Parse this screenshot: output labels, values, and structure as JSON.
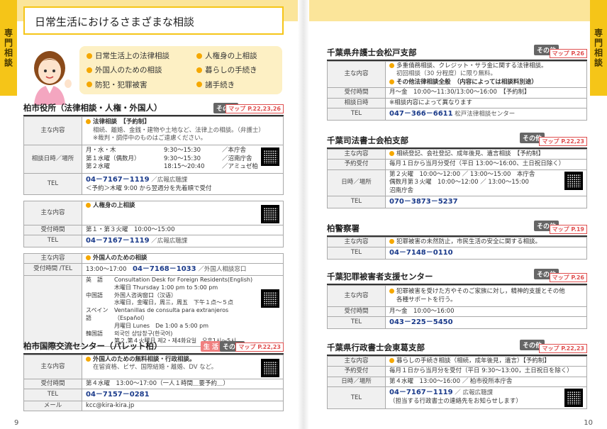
{
  "tabs": {
    "left": "専門相談",
    "right": "専門相談"
  },
  "page_numbers": {
    "left": "9",
    "right": "10"
  },
  "title": "日常生活におけるさまざまな相談",
  "topics": [
    "日常生活上の法律相談",
    "人権身の上相談",
    "外国人のための相談",
    "暮らしの手続き",
    "防犯・犯罪被害",
    "諸手続き"
  ],
  "kashiwa": {
    "name": "柏市役所（法律相談・人権・外国人）",
    "tag": "その他",
    "map": "マップ P.22,23,26",
    "label_content": "主な内容",
    "law_title": "法律相談　【予約制】",
    "law_desc": "相続、離婚、金銭・建物や土地など、法律上の相談。（弁護士）",
    "law_note": "※裁判・調停中のものはご遠慮ください。",
    "label_date": "相談日時／場所",
    "s1_day": "月・水・木",
    "s1_time": "9:30～15:30",
    "s1_place": "／本庁舎",
    "s2_day": "第１水曜（偶数月）",
    "s2_time": "9:30～15:30",
    "s2_place": "／沼南庁舎",
    "s3_day": "第２水曜",
    "s3_time": "18:15～20:40",
    "s3_place": "／アミュゼ柏",
    "label_tel": "TEL",
    "tel": "04－7167－1119",
    "tel_note": "／広報広聴課",
    "tel_note2": "＜予約＞木曜 9:00 から翌週分を先着順で受付",
    "jinken_content": "人権身の上相談",
    "label_time": "受付時間",
    "jinken_time": "第１・第３火曜　10:00～15:00",
    "jinken_tel": "04－7167－1119",
    "jinken_tel_note": "／広報広聴課",
    "foreign_content": "外国人のための相談",
    "label_time_tel": "受付時間 /TEL",
    "foreign_time": "13:00～17:00",
    "foreign_tel": "04－7168－1033",
    "foreign_tel_note": "／外国人相談窓口",
    "en_lang": "英　語",
    "en_1": "Consultation Desk for Foreign Residents(English)",
    "en_2": "木曜日 Thursday 1:00 pm to 5:00 pm",
    "cn_lang": "中国語",
    "cn_1": "外国人咨询窗口（汉语）",
    "cn_2": "水曜日，金曜日，周三，周五　下午１点～５点",
    "es_lang": "スペイン語",
    "es_1": "Ventanillas de consulta para extranjeros（Español）",
    "es_2": "月曜日 Lunes　De 1:00 a 5:00 pm",
    "kr_lang": "韓国語",
    "kr_1": "외국인 상담창구(한국어)",
    "kr_2": "第２,第４火曜日 제2・제4화요일　오후1시～5시"
  },
  "palette": {
    "name": "柏市国際交流センター（パレット柏）",
    "tag_life": "生 活",
    "tag": "その他",
    "map": "マップ P.22,23",
    "content_title": "外国人のための無料相談・行政相談。",
    "content_desc": "在留資格、ビザ、国際結婚・離婚、DV など。",
    "time": "第４水曜　13:00～17:00（一人１時間＿要予約＿）",
    "tel": "04－7157－0281",
    "label_mail": "メール",
    "mail": "kcc@kira-kira.jp"
  },
  "bengoshi": {
    "name": "千葉県弁護士会松戸支部",
    "tag": "その他",
    "map": "マップ P.26",
    "c1": "多重債務相談、クレジット・サラ金に関する法律相談。",
    "c1b": "初回相談（30 分程度）に限り無料。",
    "c2": "その他法律相談全般　（内容によっては相談料別途）",
    "time": "月～金　10:00～11:30/13:00～16:00　【予約制】",
    "label_date": "相談日時",
    "date": "※相談内容によって異なります",
    "tel": "047－366－6611",
    "tel_note": "松戸法律相談センター"
  },
  "shiho": {
    "name": "千葉司法書士会柏支部",
    "tag": "その他",
    "map": "マップ P.22,23",
    "content": "相続登記、会社登記、成年後見、遺言相談　【予約制】",
    "label_yoyaku": "予約受付",
    "yoyaku": "毎月１日から当月分受付（平日 13:00～16:00、土日祝日除く）",
    "label_date": "日時／場所",
    "d1": "第２火曜　10:00～12:00 ／ 13:00～15:00　本庁舎",
    "d2": "偶数月第３火曜　10:00～12:00 ／ 13:00～15:00",
    "d3": "沼南庁舎",
    "tel": "070－3873－5237"
  },
  "police": {
    "name": "柏警察署",
    "tag": "その他",
    "map": "マップ P.19",
    "content": "犯罪被害の未然防止，市民生活の安全に関する相談。",
    "tel": "04－7148－0110"
  },
  "victim": {
    "name": "千葉犯罪被害者支援センター",
    "tag": "その他",
    "map": "マップ P.26",
    "c1": "犯罪被害を受けた方やそのご家族に対し，精神的支援とその他",
    "c2": "各種サポートを行う。",
    "time": "月～金　10:00～16:00",
    "tel": "043－225－5450"
  },
  "gyosei": {
    "name": "千葉県行政書士会東葛支部",
    "tag": "その他",
    "map": "マップ P.22,23",
    "content": "暮らしの手続き相談（相続，成年後見，遺言）【予約制】",
    "yoyaku": "毎月１日から当月分を受付（平日 9:30～13:00，土日祝日を除く）",
    "date": "第４水曜　13:00～16:00 ／ 柏市役所本庁舎",
    "tel": "04－7167－1119",
    "tel_note": "／ 広報広聴課",
    "tel_note2": "（担当する行政書士の連絡先をお知らせします）"
  },
  "labels": {
    "content": "主な内容",
    "time": "受付時間",
    "tel": "TEL",
    "yoyaku": "予約受付",
    "date": "日時／場所"
  }
}
